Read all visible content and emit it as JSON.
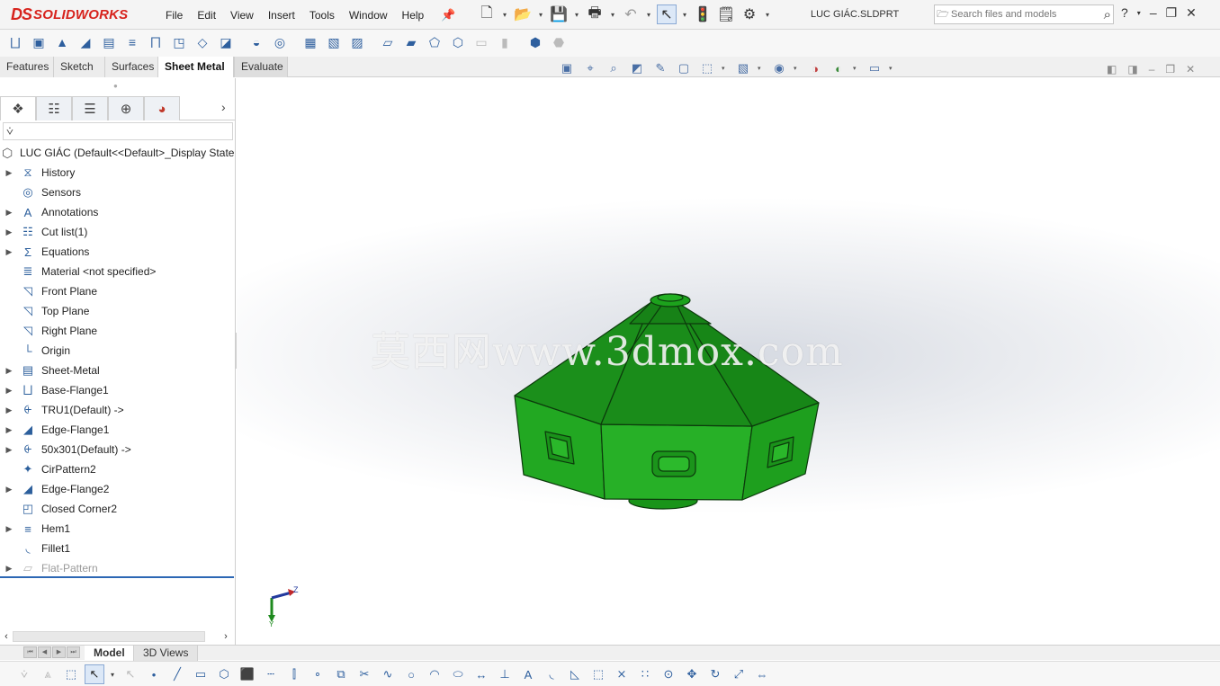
{
  "app": {
    "logo_mark": "DS",
    "logo_word": "SOLIDWORKS",
    "brand_color": "#d7231d"
  },
  "menu": [
    "File",
    "Edit",
    "View",
    "Insert",
    "Tools",
    "Window",
    "Help"
  ],
  "document_title": "LUC GIÁC.SLDPRT",
  "search": {
    "placeholder": "Search files and models"
  },
  "tabs": [
    {
      "label": "Features",
      "active": false
    },
    {
      "label": "Sketch",
      "active": false
    },
    {
      "label": "Surfaces",
      "active": false
    },
    {
      "label": "Sheet Metal",
      "active": true
    },
    {
      "label": "Evaluate",
      "active": false
    }
  ],
  "tree": {
    "root": "LUC GIÁC  (Default<<Default>_Display State",
    "items": [
      {
        "label": "History",
        "icon": "history-icon",
        "expandable": true
      },
      {
        "label": "Sensors",
        "icon": "sensors-icon",
        "expandable": false
      },
      {
        "label": "Annotations",
        "icon": "annotations-icon",
        "expandable": true
      },
      {
        "label": "Cut list(1)",
        "icon": "cut-list-icon",
        "expandable": true
      },
      {
        "label": "Equations",
        "icon": "equations-icon",
        "expandable": true
      },
      {
        "label": "Material <not specified>",
        "icon": "material-icon",
        "expandable": false
      },
      {
        "label": "Front Plane",
        "icon": "plane-icon",
        "expandable": false
      },
      {
        "label": "Top Plane",
        "icon": "plane-icon",
        "expandable": false
      },
      {
        "label": "Right Plane",
        "icon": "plane-icon",
        "expandable": false
      },
      {
        "label": "Origin",
        "icon": "origin-icon",
        "expandable": false
      },
      {
        "label": "Sheet-Metal",
        "icon": "sheet-metal-icon",
        "expandable": true
      },
      {
        "label": "Base-Flange1",
        "icon": "base-flange-icon",
        "expandable": true
      },
      {
        "label": "TRU1(Default) ->",
        "icon": "forming-tool-icon",
        "expandable": true
      },
      {
        "label": "Edge-Flange1",
        "icon": "edge-flange-icon",
        "expandable": true
      },
      {
        "label": "50x301(Default) ->",
        "icon": "forming-tool-icon",
        "expandable": true
      },
      {
        "label": "CirPattern2",
        "icon": "circular-pattern-icon",
        "expandable": false
      },
      {
        "label": "Edge-Flange2",
        "icon": "edge-flange-icon",
        "expandable": true
      },
      {
        "label": "Closed Corner2",
        "icon": "closed-corner-icon",
        "expandable": false
      },
      {
        "label": "Hem1",
        "icon": "hem-icon",
        "expandable": true
      },
      {
        "label": "Fillet1",
        "icon": "fillet-icon",
        "expandable": false
      },
      {
        "label": "Flat-Pattern",
        "icon": "flat-pattern-icon",
        "expandable": true,
        "suppressed": true
      }
    ]
  },
  "watermark": "莫西网www.3dmox.com",
  "bottom_tabs": {
    "model": "Model",
    "views": "3D Views"
  },
  "triad": {
    "z": "Z",
    "y": "Y"
  },
  "colors": {
    "model_green": "#1fa31f",
    "model_green_dark": "#137d13",
    "tree_separator": "#2c67b4"
  }
}
